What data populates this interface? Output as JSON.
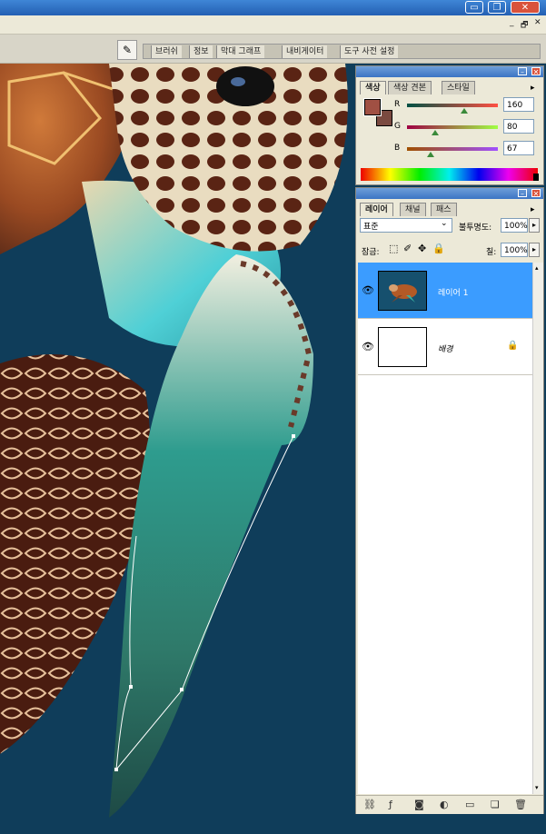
{
  "window": {
    "minimize_glyph": "▭",
    "restore_glyph": "❐",
    "close_glyph": "✕",
    "doc_minimize_glyph": "_",
    "doc_restore_glyph": "🗗",
    "doc_close_glyph": "✕"
  },
  "palette_well": {
    "tabs": [
      "브러쉬",
      "정보",
      "막대 그래프",
      "내비게이터",
      "도구 사전 설정"
    ]
  },
  "color_panel": {
    "tabs": [
      "색상",
      "색상 견본",
      "스타일"
    ],
    "foreground": "#a05043",
    "background": "#7a4a40",
    "channels": [
      {
        "label": "R",
        "value": "160",
        "level": 0.63,
        "gradient": "linear-gradient(90deg,#005043,#ff5043)"
      },
      {
        "label": "G",
        "value": "80",
        "level": 0.31,
        "gradient": "linear-gradient(90deg,#a00043,#a0ff43)"
      },
      {
        "label": "B",
        "value": "67",
        "level": 0.26,
        "gradient": "linear-gradient(90deg,#a05000,#a050ff)"
      }
    ]
  },
  "layers_panel": {
    "tabs": [
      "레이어",
      "채널",
      "패스"
    ],
    "blend_mode": "표준",
    "opacity_label": "불투명도:",
    "opacity_value": "100%",
    "lock_label": "잠금:",
    "fill_label": "칠:",
    "fill_value": "100%",
    "layers": [
      {
        "name": "레이어 1",
        "selected": true,
        "visible": true
      },
      {
        "name": "배경",
        "selected": false,
        "visible": true,
        "locked": true
      }
    ]
  },
  "accent_color": "#3b9cff"
}
